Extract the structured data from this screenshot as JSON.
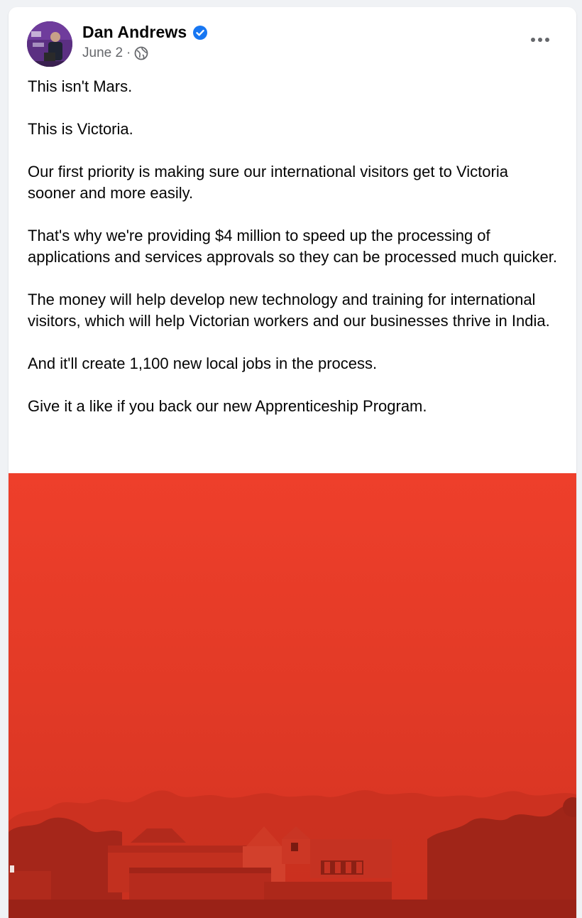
{
  "post": {
    "author": "Dan Andrews",
    "verified_icon": "verified-badge-icon",
    "date": "June 2",
    "separator": "·",
    "audience_icon": "globe-icon",
    "more_icon": "more-options-icon",
    "paragraphs": [
      "This isn't Mars.",
      "This is Victoria.",
      "Our first priority is making sure our international visitors get to Victoria sooner and more easily.",
      "That's why we're providing $4 million to speed up the processing of applications and services approvals so they can be processed much quicker.",
      "The money will help develop new technology and training for international visitors, which will help Victorian workers and our businesses thrive in India.",
      "And it'll create 1,100 new local jobs in the process.",
      "Give it a like if you back our new Apprenticeship Program."
    ]
  },
  "colors": {
    "verified_blue": "#1877f2",
    "sky_red": "#e8402b",
    "text_primary": "#050505",
    "text_secondary": "#65676b"
  }
}
